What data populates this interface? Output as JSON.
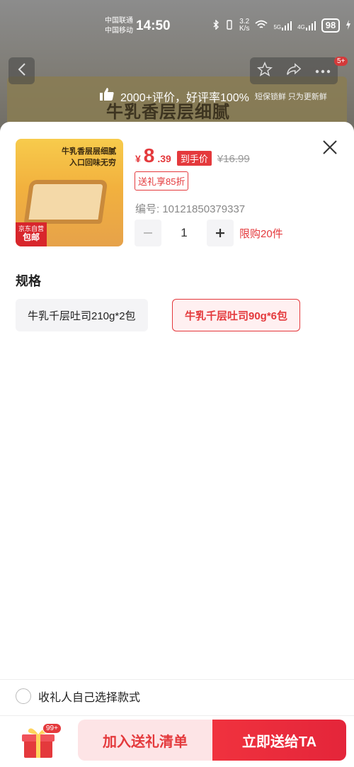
{
  "status_bar": {
    "carrier_1": "中国联通",
    "carrier_2": "中国移动",
    "time": "14:50",
    "speed": "3.2",
    "speed_unit": "K/s",
    "net_1": "5G",
    "net_2": "4G",
    "battery": "98"
  },
  "background": {
    "badge": "5+",
    "banner_text": "牛乳香层层细腻",
    "review_text": "2000+评价，好评率100%",
    "review_sub": "短保锁鲜 只为更新鲜"
  },
  "product": {
    "thumb_text_1": "牛乳香层层细腻",
    "thumb_text_2": "入口回味无穷",
    "thumb_tag_1": "京东自营",
    "thumb_tag_2": "包邮",
    "price_symbol": "¥",
    "price_int": "8",
    "price_dec": ".39",
    "price_tag": "到手价",
    "price_old": "¥16.99",
    "gift_discount": "送礼享85折",
    "code": "编号: 10121850379337",
    "quantity": "1",
    "limit": "限购20件"
  },
  "spec": {
    "title": "规格",
    "options": [
      "牛乳千层吐司210g*2包",
      "牛乳千层吐司90g*6包"
    ],
    "selected_index": 1
  },
  "footer": {
    "choose_label": "收礼人自己选择款式",
    "gift_badge": "99+",
    "add_label": "加入送礼清单",
    "send_label": "立即送给TA"
  },
  "colors": {
    "accent": "#e4393c"
  }
}
